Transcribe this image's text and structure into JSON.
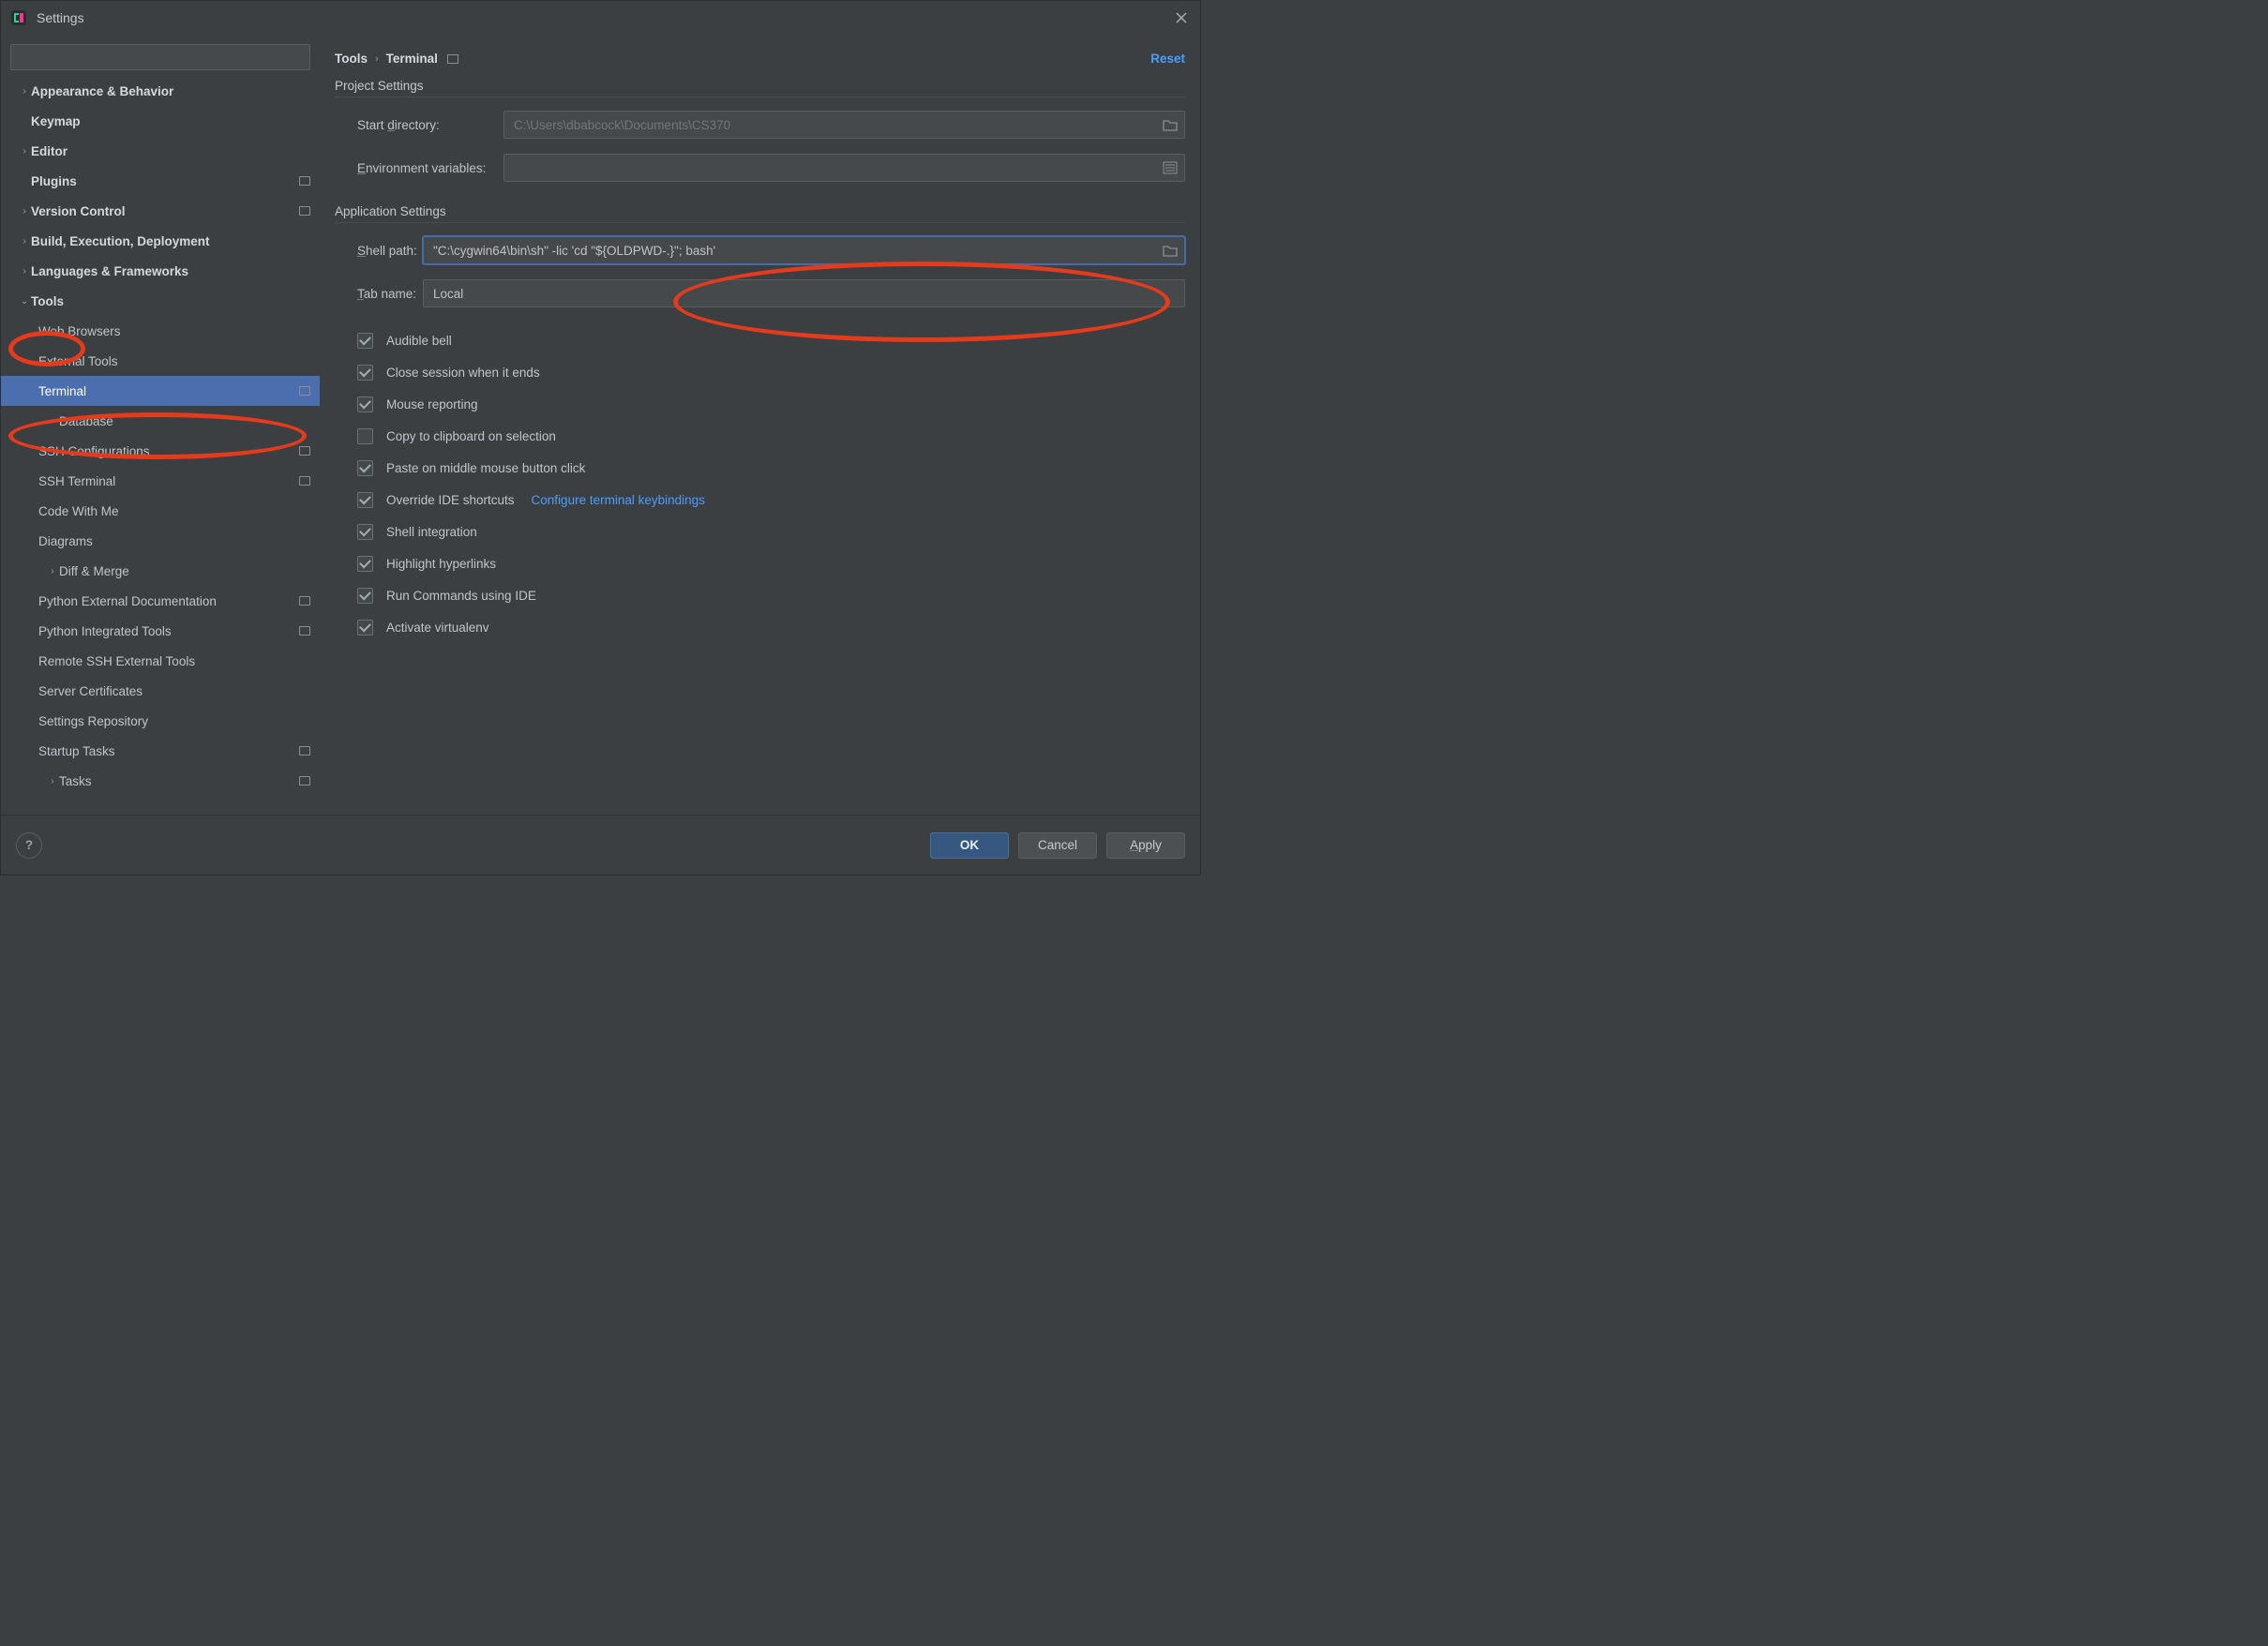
{
  "titlebar": {
    "title": "Settings"
  },
  "sidebar": {
    "search_placeholder": "",
    "items": [
      {
        "label": "Appearance & Behavior",
        "arrow": "›",
        "indent": 0,
        "bold": true
      },
      {
        "label": "Keymap",
        "arrow": "",
        "indent": 0,
        "bold": true
      },
      {
        "label": "Editor",
        "arrow": "›",
        "indent": 0,
        "bold": true
      },
      {
        "label": "Plugins",
        "arrow": "",
        "indent": 0,
        "bold": true,
        "badge": true
      },
      {
        "label": "Version Control",
        "arrow": "›",
        "indent": 0,
        "bold": true,
        "badge": true
      },
      {
        "label": "Build, Execution, Deployment",
        "arrow": "›",
        "indent": 0,
        "bold": true
      },
      {
        "label": "Languages & Frameworks",
        "arrow": "›",
        "indent": 0,
        "bold": true
      },
      {
        "label": "Tools",
        "arrow": "⌄",
        "indent": 0,
        "bold": true
      },
      {
        "label": "Web Browsers",
        "arrow": "",
        "indent": 1
      },
      {
        "label": "External Tools",
        "arrow": "",
        "indent": 1
      },
      {
        "label": "Terminal",
        "arrow": "",
        "indent": 1,
        "selected": true,
        "badge": true
      },
      {
        "label": "Database",
        "arrow": "›",
        "indent": 1,
        "arrowIndent": true
      },
      {
        "label": "SSH Configurations",
        "arrow": "",
        "indent": 1,
        "badge": true
      },
      {
        "label": "SSH Terminal",
        "arrow": "",
        "indent": 1,
        "badge": true
      },
      {
        "label": "Code With Me",
        "arrow": "",
        "indent": 1
      },
      {
        "label": "Diagrams",
        "arrow": "",
        "indent": 1
      },
      {
        "label": "Diff & Merge",
        "arrow": "›",
        "indent": 1,
        "arrowIndent": true
      },
      {
        "label": "Python External Documentation",
        "arrow": "",
        "indent": 1,
        "badge": true
      },
      {
        "label": "Python Integrated Tools",
        "arrow": "",
        "indent": 1,
        "badge": true
      },
      {
        "label": "Remote SSH External Tools",
        "arrow": "",
        "indent": 1
      },
      {
        "label": "Server Certificates",
        "arrow": "",
        "indent": 1
      },
      {
        "label": "Settings Repository",
        "arrow": "",
        "indent": 1
      },
      {
        "label": "Startup Tasks",
        "arrow": "",
        "indent": 1,
        "badge": true
      },
      {
        "label": "Tasks",
        "arrow": "›",
        "indent": 1,
        "arrowIndent": true,
        "badge": true
      }
    ]
  },
  "breadcrumb": {
    "parent": "Tools",
    "current": "Terminal",
    "reset": "Reset"
  },
  "project_settings": {
    "title": "Project Settings",
    "start_dir_label": "Start directory:",
    "start_dir_placeholder": "C:\\Users\\dbabcock\\Documents\\CS370",
    "env_label": "Environment variables:",
    "env_value": ""
  },
  "application_settings": {
    "title": "Application Settings",
    "shell_label": "Shell path:",
    "shell_value": "\"C:\\cygwin64\\bin\\sh\" -lic 'cd \"${OLDPWD-.}\"; bash'",
    "tab_label": "Tab name:",
    "tab_value": "Local",
    "checks": [
      {
        "label": "Audible bell",
        "checked": true
      },
      {
        "label": "Close session when it ends",
        "checked": true
      },
      {
        "label": "Mouse reporting",
        "checked": true
      },
      {
        "label": "Copy to clipboard on selection",
        "checked": false
      },
      {
        "label": "Paste on middle mouse button click",
        "checked": true
      },
      {
        "label": "Override IDE shortcuts",
        "checked": true,
        "link": "Configure terminal keybindings"
      },
      {
        "label": "Shell integration",
        "checked": true
      },
      {
        "label": "Highlight hyperlinks",
        "checked": true
      },
      {
        "label": "Run Commands using IDE",
        "checked": true
      },
      {
        "label": "Activate virtualenv",
        "checked": true
      }
    ]
  },
  "footer": {
    "ok": "OK",
    "cancel": "Cancel",
    "apply": "Apply"
  }
}
